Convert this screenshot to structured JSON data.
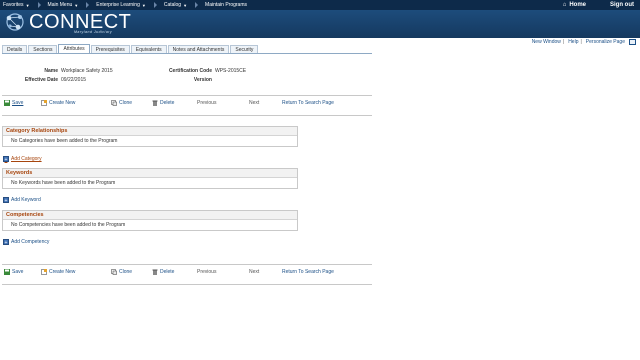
{
  "topnav": {
    "items": [
      "Favorites",
      "Main Menu",
      "Enterprise Learning",
      "Catalog",
      "Maintain Programs"
    ],
    "home": "Home",
    "signout": "Sign out"
  },
  "brand": {
    "name": "CONNECT",
    "subtitle": "Maryland Judiciary"
  },
  "utility": {
    "new_window": "New Window",
    "help": "Help",
    "personalize": "Personalize Page"
  },
  "tabs": [
    "Details",
    "Sections",
    "Attributes",
    "Prerequisites",
    "Equivalents",
    "Notes and Attachments",
    "Security"
  ],
  "active_tab": "Attributes",
  "fields": {
    "name_label": "Name",
    "name_value": "Workplace Safety 2015",
    "effective_date_label": "Effective Date",
    "effective_date_value": "09/22/2015",
    "cert_code_label": "Certification Code",
    "cert_code_value": "WPS-2015CE",
    "version_label": "Version",
    "version_value": ""
  },
  "toolbar": {
    "save": "Save",
    "create_new": "Create New",
    "clone": "Clone",
    "delete": "Delete",
    "previous": "Previous",
    "next": "Next",
    "return": "Return To Search Page"
  },
  "sections": {
    "category": {
      "title": "Category Relationships",
      "empty": "No Categories have been added to the Program",
      "add": "Add Category"
    },
    "keywords": {
      "title": "Keywords",
      "empty": "No Keywords have been added to the Program",
      "add": "Add Keyword"
    },
    "competencies": {
      "title": "Competencies",
      "empty": "No Competencies have been added to the Program",
      "add": "Add Competency"
    }
  },
  "colors": {
    "nav_bg": "#0d2a4a",
    "banner_bg": "#1d4c7c",
    "link": "#1b4f86",
    "section_title": "#a7450d"
  }
}
